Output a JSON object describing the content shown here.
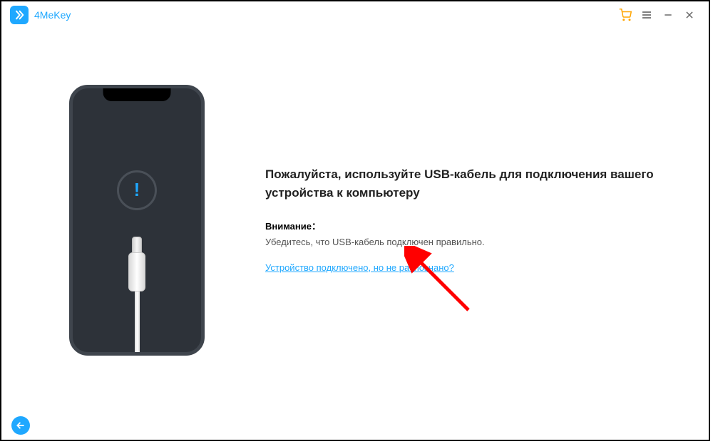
{
  "app": {
    "title": "4MeKey"
  },
  "main": {
    "heading": "Пожалуйста, используйте USB-кабель для подключения вашего устройства к компьютеру",
    "attention_label": "Внимание：",
    "attention_text": "Убедитесь, что USB-кабель подключен правильно.",
    "help_link": "Устройство подключено, но не распознано?"
  },
  "icons": {
    "alert": "!"
  }
}
